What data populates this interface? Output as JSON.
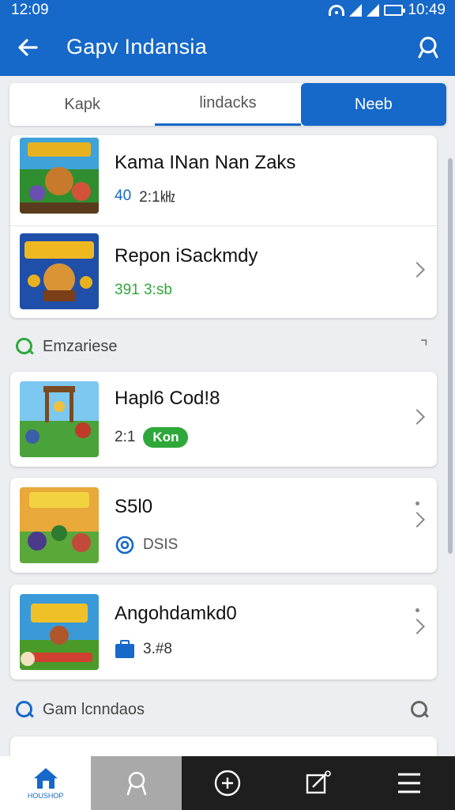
{
  "status_bar": {
    "time": "12:09",
    "right_time": "10:49"
  },
  "app_bar": {
    "title": "Gapv Indansia"
  },
  "tabs": [
    {
      "label": "Kapk"
    },
    {
      "label": "lindacks"
    },
    {
      "label": "Neeb"
    }
  ],
  "group1": {
    "items": [
      {
        "title": "Kama INan Nan Zaks",
        "meta_a": "40",
        "meta_b": "2:1㎑"
      },
      {
        "title": "Repon iSackmdy",
        "meta_a": "391 3:sb"
      }
    ]
  },
  "section1": {
    "label": "Emzariese",
    "right_glyph": "⌝"
  },
  "list": [
    {
      "title": "Hapl6 Cod!8",
      "meta": "2:1",
      "badge": "Kon"
    },
    {
      "title": "S5l0",
      "meta": "DSIS"
    },
    {
      "title": "Angohdamkd0",
      "meta": "3.#8"
    }
  ],
  "section2": {
    "label": "Gam lcnndaos"
  },
  "bottom_nav": {
    "home_sub": "HOUSHOP"
  },
  "colors": {
    "primary": "#1668c9",
    "accent_green": "#2ea83a"
  }
}
